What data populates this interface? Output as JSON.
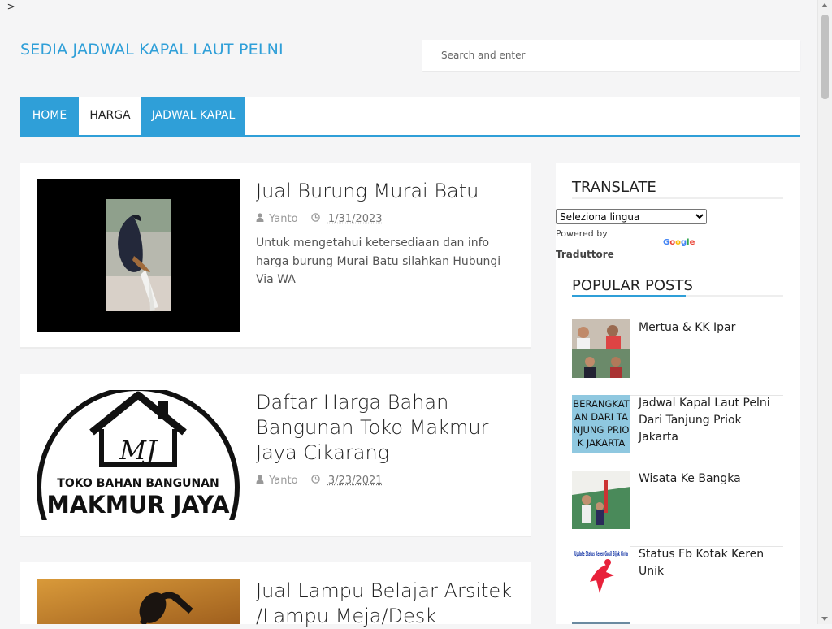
{
  "stray_text": "-->",
  "site": {
    "title": "SEDIA JADWAL KAPAL LAUT PELNI"
  },
  "search": {
    "placeholder": "Search and enter"
  },
  "nav": {
    "items": [
      {
        "label": "HOME"
      },
      {
        "label": "HARGA"
      },
      {
        "label": "JADWAL KAPAL"
      }
    ]
  },
  "posts": [
    {
      "title": "Jual Burung Murai Batu",
      "author": "Yanto",
      "date": "1/31/2023",
      "excerpt": "  Untuk mengetahui ketersediaan dan info harga burung Murai Batu silahkan Hubungi Via WA"
    },
    {
      "title": "Daftar Harga Bahan Bangunan Toko Makmur Jaya Cikarang",
      "author": "Yanto",
      "date": "3/23/2021",
      "logo_text": {
        "initials": "MJ",
        "line1": "TOKO BAHAN BANGUNAN",
        "line2": "MAKMUR JAYA"
      }
    },
    {
      "title": "Jual Lampu Belajar Arsitek /Lampu Meja/Desk"
    }
  ],
  "sidebar": {
    "translate": {
      "heading": "TRANSLATE",
      "select_value": "Seleziona lingua",
      "powered_by": "Powered by",
      "google": "Google",
      "traduttore": "Traduttore"
    },
    "popular": {
      "heading": "POPULAR POSTS",
      "items": [
        {
          "title": "Mertua & KK Ipar"
        },
        {
          "title": "Jadwal Kapal Laut Pelni Dari Tanjung Priok Jakarta",
          "thumb_text": "BERANGKATAN DARI TANJUNG PRIOK JAKARTA"
        },
        {
          "title": "Wisata Ke Bangka"
        },
        {
          "title": "Status Fb Kotak Keren Unik",
          "thumb_text": "Update Status Keren Gokil Bijak Cinta"
        }
      ]
    }
  },
  "colors": {
    "accent": "#2f9fd8",
    "page_bg": "#f5f5f6",
    "panel_bg": "#ffffff"
  },
  "icons": {
    "author": "user-icon",
    "date": "clock-icon"
  }
}
